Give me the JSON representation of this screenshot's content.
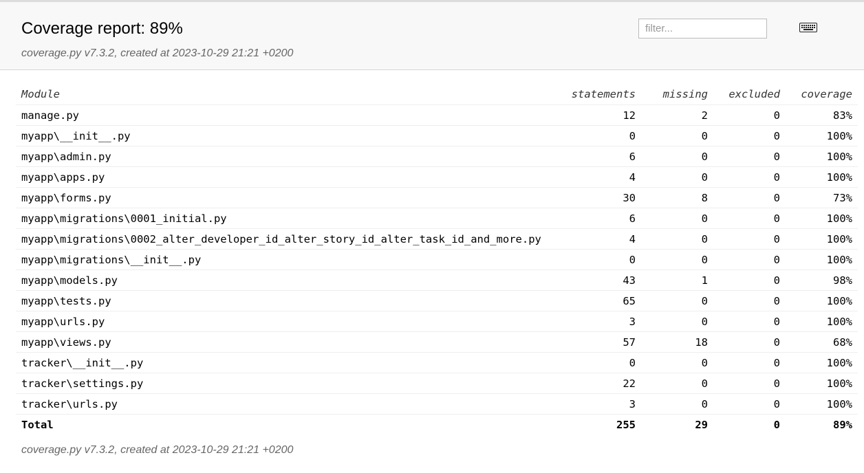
{
  "header": {
    "title": "Coverage report: 89%",
    "meta": "coverage.py v7.3.2, created at 2023-10-29 21:21 +0200",
    "filter_placeholder": "filter...",
    "filter_value": ""
  },
  "icons": {
    "keyboard": "keyboard-icon"
  },
  "table": {
    "headers": [
      "Module",
      "statements",
      "missing",
      "excluded",
      "coverage"
    ],
    "rows": [
      [
        "manage.py",
        "12",
        "2",
        "0",
        "83%"
      ],
      [
        "myapp\\__init__.py",
        "0",
        "0",
        "0",
        "100%"
      ],
      [
        "myapp\\admin.py",
        "6",
        "0",
        "0",
        "100%"
      ],
      [
        "myapp\\apps.py",
        "4",
        "0",
        "0",
        "100%"
      ],
      [
        "myapp\\forms.py",
        "30",
        "8",
        "0",
        "73%"
      ],
      [
        "myapp\\migrations\\0001_initial.py",
        "6",
        "0",
        "0",
        "100%"
      ],
      [
        "myapp\\migrations\\0002_alter_developer_id_alter_story_id_alter_task_id_and_more.py",
        "4",
        "0",
        "0",
        "100%"
      ],
      [
        "myapp\\migrations\\__init__.py",
        "0",
        "0",
        "0",
        "100%"
      ],
      [
        "myapp\\models.py",
        "43",
        "1",
        "0",
        "98%"
      ],
      [
        "myapp\\tests.py",
        "65",
        "0",
        "0",
        "100%"
      ],
      [
        "myapp\\urls.py",
        "3",
        "0",
        "0",
        "100%"
      ],
      [
        "myapp\\views.py",
        "57",
        "18",
        "0",
        "68%"
      ],
      [
        "tracker\\__init__.py",
        "0",
        "0",
        "0",
        "100%"
      ],
      [
        "tracker\\settings.py",
        "22",
        "0",
        "0",
        "100%"
      ],
      [
        "tracker\\urls.py",
        "3",
        "0",
        "0",
        "100%"
      ]
    ],
    "total": [
      "Total",
      "255",
      "29",
      "0",
      "89%"
    ]
  },
  "footer": {
    "meta": "coverage.py v7.3.2, created at 2023-10-29 21:21 +0200"
  }
}
